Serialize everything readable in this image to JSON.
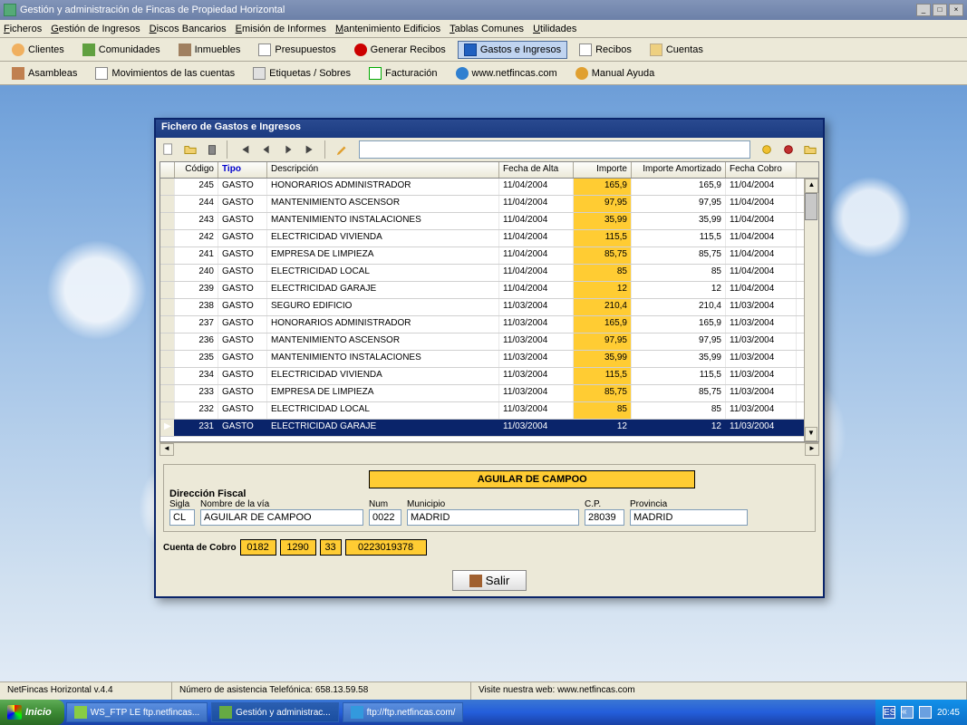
{
  "window": {
    "title": "Gestión y administración de Fincas de Propiedad Horizontal"
  },
  "menu": [
    "Ficheros",
    "Gestión de Ingresos",
    "Discos Bancarios",
    "Emisión de Informes",
    "Mantenimiento Edificios",
    "Tablas Comunes",
    "Utilidades"
  ],
  "toolbar1": [
    {
      "label": "Clientes",
      "icon": "ic-ppl"
    },
    {
      "label": "Comunidades",
      "icon": "ic-comm"
    },
    {
      "label": "Inmuebles",
      "icon": "ic-bld"
    },
    {
      "label": "Presupuestos",
      "icon": "ic-doc"
    },
    {
      "label": "Generar Recibos",
      "icon": "ic-gear"
    },
    {
      "label": "Gastos e Ingresos",
      "icon": "ic-money",
      "active": true
    },
    {
      "label": "Recibos",
      "icon": "ic-rec"
    },
    {
      "label": "Cuentas",
      "icon": "ic-acc"
    }
  ],
  "toolbar2": [
    {
      "label": "Asambleas",
      "icon": "ic-asm"
    },
    {
      "label": "Movimientos de las cuentas",
      "icon": "ic-mov"
    },
    {
      "label": "Etiquetas / Sobres",
      "icon": "ic-lbl"
    },
    {
      "label": "Facturación",
      "icon": "ic-inv"
    },
    {
      "label": "www.netfincas.com",
      "icon": "ic-web"
    },
    {
      "label": "Manual Ayuda",
      "icon": "ic-help"
    }
  ],
  "dialog": {
    "title": "Fichero de Gastos e Ingresos",
    "columns": [
      "Código",
      "Tipo",
      "Descripción",
      "Fecha de Alta",
      "Importe",
      "Importe Amortizado",
      "Fecha Cobro"
    ],
    "rows": [
      {
        "cod": "231",
        "tipo": "GASTO",
        "desc": "ELECTRICIDAD GARAJE",
        "fa": "11/03/2004",
        "imp": "12",
        "ima": "12",
        "fc": "11/03/2004",
        "sel": true
      },
      {
        "cod": "232",
        "tipo": "GASTO",
        "desc": "ELECTRICIDAD LOCAL",
        "fa": "11/03/2004",
        "imp": "85",
        "ima": "85",
        "fc": "11/03/2004"
      },
      {
        "cod": "233",
        "tipo": "GASTO",
        "desc": "EMPRESA DE LIMPIEZA",
        "fa": "11/03/2004",
        "imp": "85,75",
        "ima": "85,75",
        "fc": "11/03/2004"
      },
      {
        "cod": "234",
        "tipo": "GASTO",
        "desc": "ELECTRICIDAD VIVIENDA",
        "fa": "11/03/2004",
        "imp": "115,5",
        "ima": "115,5",
        "fc": "11/03/2004"
      },
      {
        "cod": "235",
        "tipo": "GASTO",
        "desc": "MANTENIMIENTO INSTALACIONES",
        "fa": "11/03/2004",
        "imp": "35,99",
        "ima": "35,99",
        "fc": "11/03/2004"
      },
      {
        "cod": "236",
        "tipo": "GASTO",
        "desc": "MANTENIMIENTO ASCENSOR",
        "fa": "11/03/2004",
        "imp": "97,95",
        "ima": "97,95",
        "fc": "11/03/2004"
      },
      {
        "cod": "237",
        "tipo": "GASTO",
        "desc": "HONORARIOS ADMINISTRADOR",
        "fa": "11/03/2004",
        "imp": "165,9",
        "ima": "165,9",
        "fc": "11/03/2004"
      },
      {
        "cod": "238",
        "tipo": "GASTO",
        "desc": "SEGURO EDIFICIO",
        "fa": "11/03/2004",
        "imp": "210,4",
        "ima": "210,4",
        "fc": "11/03/2004"
      },
      {
        "cod": "239",
        "tipo": "GASTO",
        "desc": "ELECTRICIDAD GARAJE",
        "fa": "11/04/2004",
        "imp": "12",
        "ima": "12",
        "fc": "11/04/2004"
      },
      {
        "cod": "240",
        "tipo": "GASTO",
        "desc": "ELECTRICIDAD LOCAL",
        "fa": "11/04/2004",
        "imp": "85",
        "ima": "85",
        "fc": "11/04/2004"
      },
      {
        "cod": "241",
        "tipo": "GASTO",
        "desc": "EMPRESA DE LIMPIEZA",
        "fa": "11/04/2004",
        "imp": "85,75",
        "ima": "85,75",
        "fc": "11/04/2004"
      },
      {
        "cod": "242",
        "tipo": "GASTO",
        "desc": "ELECTRICIDAD VIVIENDA",
        "fa": "11/04/2004",
        "imp": "115,5",
        "ima": "115,5",
        "fc": "11/04/2004"
      },
      {
        "cod": "243",
        "tipo": "GASTO",
        "desc": "MANTENIMIENTO INSTALACIONES",
        "fa": "11/04/2004",
        "imp": "35,99",
        "ima": "35,99",
        "fc": "11/04/2004"
      },
      {
        "cod": "244",
        "tipo": "GASTO",
        "desc": "MANTENIMIENTO ASCENSOR",
        "fa": "11/04/2004",
        "imp": "97,95",
        "ima": "97,95",
        "fc": "11/04/2004"
      },
      {
        "cod": "245",
        "tipo": "GASTO",
        "desc": "HONORARIOS ADMINISTRADOR",
        "fa": "11/04/2004",
        "imp": "165,9",
        "ima": "165,9",
        "fc": "11/04/2004"
      }
    ],
    "address": {
      "section": "Dirección Fiscal",
      "banner": "AGUILAR DE CAMPOO",
      "sigla_label": "Sigla",
      "sigla": "CL",
      "via_label": "Nombre de la vía",
      "via": "AGUILAR DE CAMPOO",
      "num_label": "Num",
      "num": "0022",
      "muni_label": "Municipio",
      "muni": "MADRID",
      "cp_label": "C.P.",
      "cp": "28039",
      "prov_label": "Provincia",
      "prov": "MADRID"
    },
    "cuenta": {
      "label": "Cuenta de Cobro",
      "p1": "0182",
      "p2": "1290",
      "p3": "33",
      "p4": "0223019378"
    },
    "salir": "Salir"
  },
  "status": {
    "ver": "NetFincas Horizontal v.4.4",
    "tel": "Número de asistencia Telefónica: 658.13.59.58",
    "web": "Visite nuestra web: www.netfincas.com"
  },
  "taskbar": {
    "start": "Inicio",
    "tasks": [
      "WS_FTP LE ftp.netfincas...",
      "Gestión y administrac...",
      "ftp://ftp.netfincas.com/"
    ],
    "lang": "ES",
    "time": "20:45"
  }
}
